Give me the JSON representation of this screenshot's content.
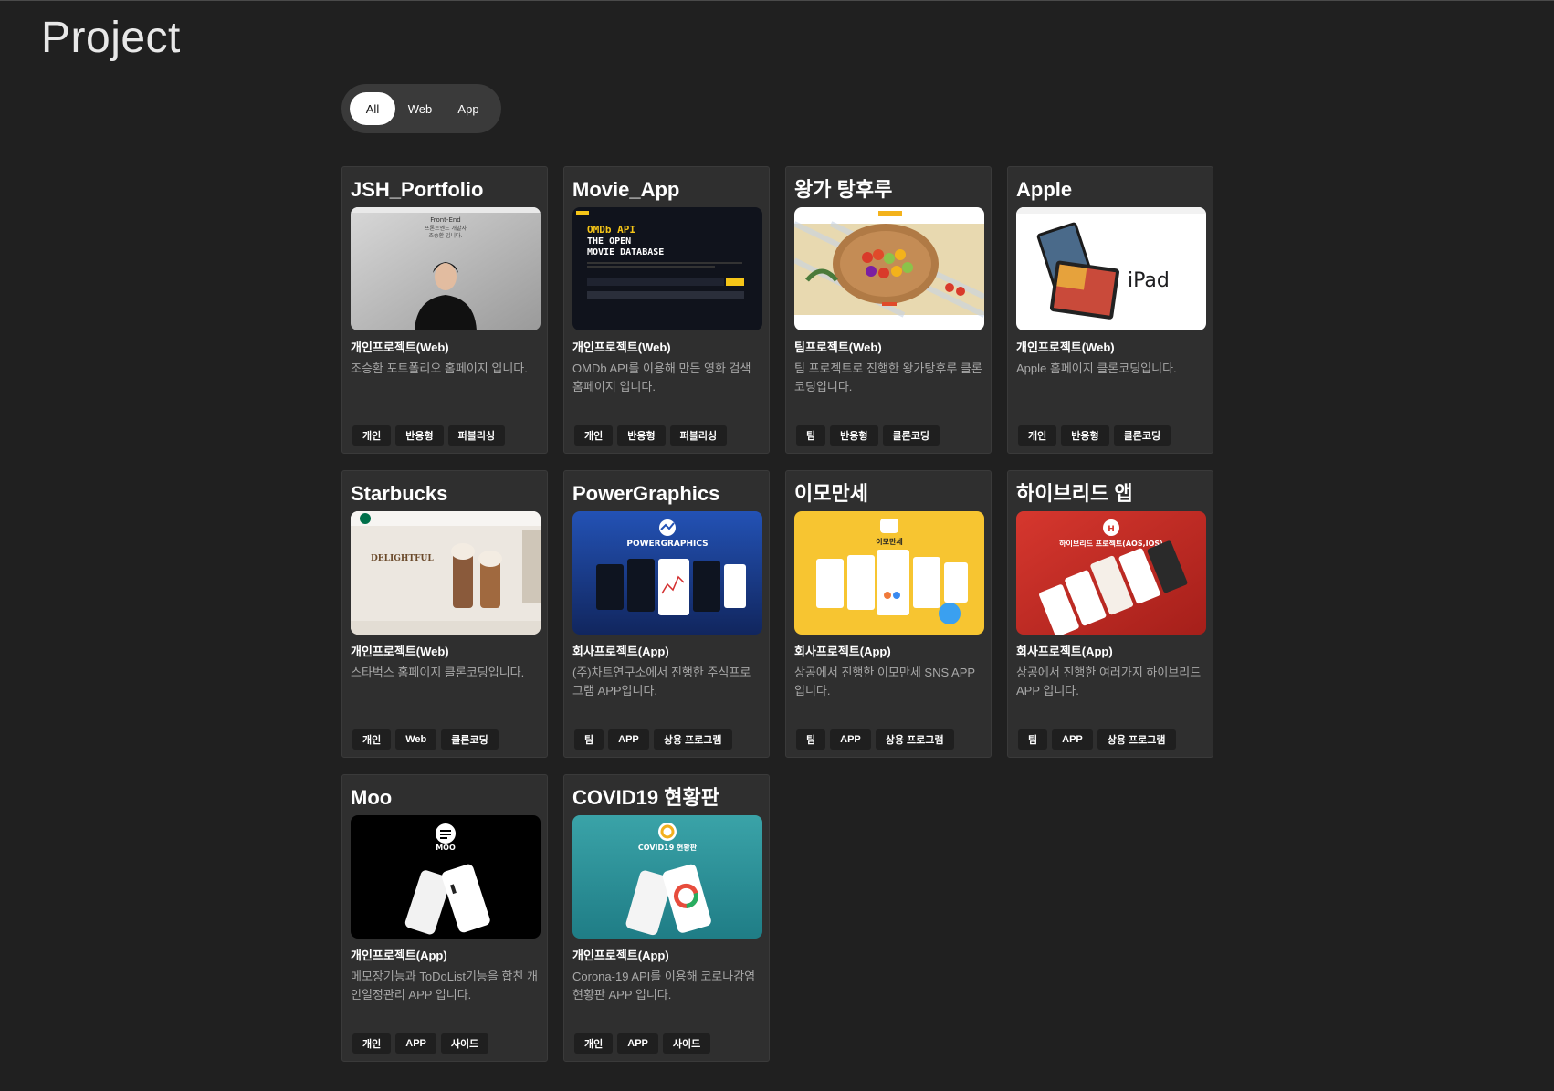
{
  "page": {
    "title": "Project"
  },
  "filters": [
    {
      "label": "All",
      "active": true
    },
    {
      "label": "Web",
      "active": false
    },
    {
      "label": "App",
      "active": false
    }
  ],
  "projects": [
    {
      "title": "JSH_Portfolio",
      "kind": "개인프로젝트(Web)",
      "desc": "조승환 포트폴리오 홈페이지 입니다.",
      "tags": [
        "개인",
        "반응형",
        "퍼블리싱"
      ],
      "thumb": {
        "style": "portfolio",
        "text1": "Front-End",
        "text2": "프론트엔드 개발자",
        "text3": "조승환 입니다."
      }
    },
    {
      "title": "Movie_App",
      "kind": "개인프로젝트(Web)",
      "desc": "OMDb API를 이용해 만든 영화 검색 홈페이지 입니다.",
      "tags": [
        "개인",
        "반응형",
        "퍼블리싱"
      ],
      "thumb": {
        "style": "movie",
        "text1": "OMDb API",
        "text2": "THE OPEN",
        "text3": "MOVIE DATABASE"
      }
    },
    {
      "title": "왕가 탕후루",
      "kind": "팀프로젝트(Web)",
      "desc": "팀 프로젝트로 진행한 왕가탕후루 클론코딩입니다.",
      "tags": [
        "팀",
        "반응형",
        "클론코딩"
      ],
      "thumb": {
        "style": "tanghulu",
        "text1": "",
        "text2": "",
        "text3": ""
      }
    },
    {
      "title": "Apple",
      "kind": "개인프로젝트(Web)",
      "desc": "Apple 홈페이지 클론코딩입니다.",
      "tags": [
        "개인",
        "반응형",
        "클론코딩"
      ],
      "thumb": {
        "style": "apple",
        "text1": "iPad",
        "text2": "",
        "text3": ""
      }
    },
    {
      "title": "Starbucks",
      "kind": "개인프로젝트(Web)",
      "desc": "스타벅스 홈페이지 클론코딩입니다.",
      "tags": [
        "개인",
        "Web",
        "클론코딩"
      ],
      "thumb": {
        "style": "starbucks",
        "text1": "DELIGHTFUL",
        "text2": "",
        "text3": ""
      }
    },
    {
      "title": "PowerGraphics",
      "kind": "회사프로젝트(App)",
      "desc": "(주)차트연구소에서 진행한 주식프로그램 APP입니다.",
      "tags": [
        "팀",
        "APP",
        "상용 프로그램"
      ],
      "thumb": {
        "style": "power",
        "text1": "POWERGRAPHICS",
        "text2": "",
        "text3": ""
      }
    },
    {
      "title": "이모만세",
      "kind": "회사프로젝트(App)",
      "desc": "상공에서 진행한 이모만세 SNS APP 입니다.",
      "tags": [
        "팀",
        "APP",
        "상용 프로그램"
      ],
      "thumb": {
        "style": "imo",
        "text1": "이모만세",
        "text2": "",
        "text3": ""
      }
    },
    {
      "title": "하이브리드 앱",
      "kind": "회사프로젝트(App)",
      "desc": "상공에서 진행한 여러가지 하이브리드 APP 입니다.",
      "tags": [
        "팀",
        "APP",
        "상용 프로그램"
      ],
      "thumb": {
        "style": "hybrid",
        "text1": "하이브리드 프로젝트(AOS,IOS)",
        "text2": "",
        "text3": ""
      }
    },
    {
      "title": "Moo",
      "kind": "개인프로젝트(App)",
      "desc": "메모장기능과 ToDoList기능을 합친 개인일정관리 APP 입니다.",
      "tags": [
        "개인",
        "APP",
        "사이드"
      ],
      "thumb": {
        "style": "moo",
        "text1": "MOO",
        "text2": "",
        "text3": ""
      }
    },
    {
      "title": "COVID19 현황판",
      "kind": "개인프로젝트(App)",
      "desc": "Corona-19 API를 이용해 코로나감염현황판 APP 입니다.",
      "tags": [
        "개인",
        "APP",
        "사이드"
      ],
      "thumb": {
        "style": "covid",
        "text1": "COVID19 현황판",
        "text2": "",
        "text3": ""
      }
    }
  ]
}
